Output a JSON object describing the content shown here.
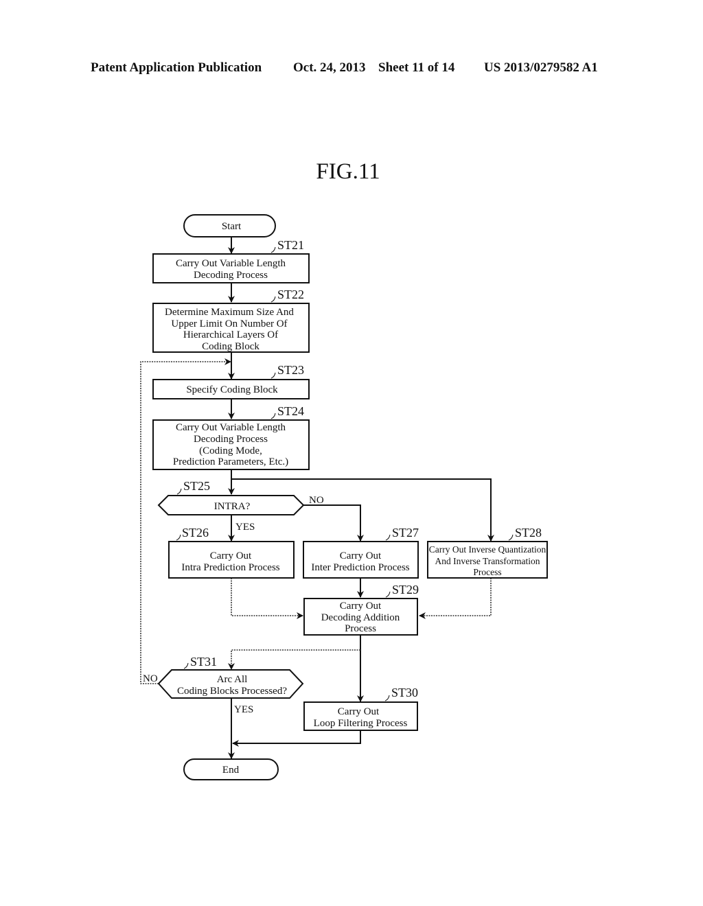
{
  "header": {
    "publication": "Patent Application Publication",
    "date": "Oct. 24, 2013",
    "sheet": "Sheet 11 of 14",
    "patent_number": "US 2013/0279582 A1"
  },
  "figure": {
    "title": "FIG.11"
  },
  "flowchart": {
    "start": "Start",
    "end": "End",
    "steps": {
      "st21": {
        "id": "ST21",
        "lines": [
          "Carry Out Variable Length",
          "Decoding Process"
        ]
      },
      "st22": {
        "id": "ST22",
        "lines": [
          "Determine Maximum Size And",
          "Upper Limit On Number Of",
          "Hierarchical Layers Of",
          "Coding Block"
        ]
      },
      "st23": {
        "id": "ST23",
        "lines": [
          "Specify Coding Block"
        ]
      },
      "st24": {
        "id": "ST24",
        "lines": [
          "Carry Out Variable Length",
          "Decoding Process",
          "(Coding Mode,",
          "Prediction Parameters, Etc.)"
        ]
      },
      "st25": {
        "id": "ST25",
        "lines": [
          "INTRA?"
        ],
        "yes": "YES",
        "no": "NO"
      },
      "st26": {
        "id": "ST26",
        "lines": [
          "Carry Out",
          "Intra Prediction Process"
        ]
      },
      "st27": {
        "id": "ST27",
        "lines": [
          "Carry Out",
          "Inter Prediction Process"
        ]
      },
      "st28": {
        "id": "ST28",
        "lines": [
          "Carry Out Inverse Quantization",
          "And Inverse Transformation",
          "Process"
        ]
      },
      "st29": {
        "id": "ST29",
        "lines": [
          "Carry Out",
          "Decoding Addition",
          "Process"
        ]
      },
      "st30": {
        "id": "ST30",
        "lines": [
          "Carry Out",
          "Loop Filtering Process"
        ]
      },
      "st31": {
        "id": "ST31",
        "lines": [
          "Arc All",
          "Coding Blocks Processed?"
        ],
        "yes": "YES",
        "no": "NO"
      }
    }
  }
}
